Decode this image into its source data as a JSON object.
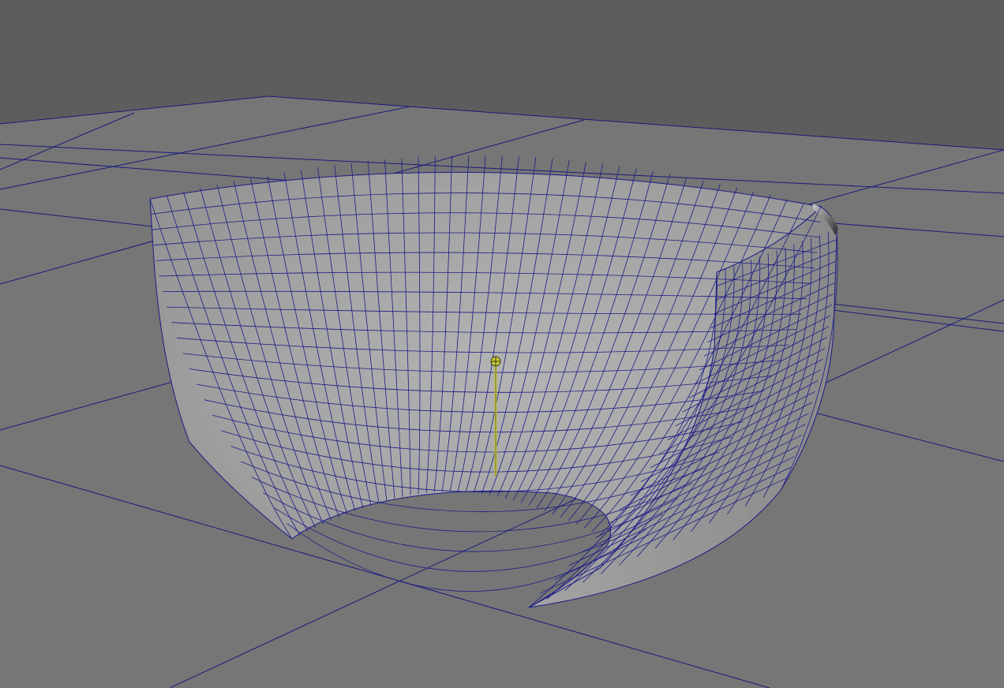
{
  "viewport": {
    "panel": "perspective-viewport",
    "background_color": "#5d5d5d",
    "ground_color": "#767676",
    "grid_line_color": "#1a1a7a",
    "wireframe_color": "#1c1c86",
    "surface_light": "#a9a9a9",
    "surface_dark": "#5a5a5a"
  },
  "objects": [
    {
      "kind": "nurbs-surface",
      "shape": "partial-hemisphere",
      "display": "shaded-with-wireframe"
    },
    {
      "kind": "manipulator",
      "shape": "pivot-handle",
      "color": "#c8c83a"
    }
  ]
}
